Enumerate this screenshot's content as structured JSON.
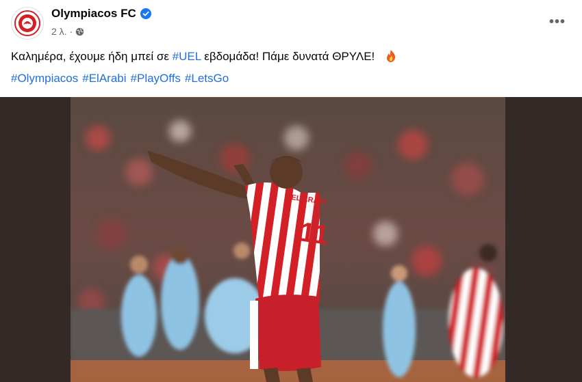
{
  "post": {
    "author": "Olympiacos FC",
    "time": "2 λ.",
    "text_before": "Καλημέρα, έχουμε ήδη μπεί σε ",
    "text_tag": "#UEL",
    "text_after": " εβδομάδα! Πάμε δυνατά ΘΡΥΛΕ!",
    "hashtags": [
      "#Olympiacos",
      "#ElArabi",
      "#PlayOffs",
      "#LetsGo"
    ],
    "more_label": "•••"
  },
  "icons": {
    "avatar": "olympiacos-crest-icon",
    "verified": "verified-badge-icon",
    "privacy": "globe-icon",
    "emoji": "fire-icon",
    "more": "more-options-icon"
  },
  "photo": {
    "jersey_number": "11",
    "player_name": "EL ARABI"
  },
  "colors": {
    "link": "#216fdb",
    "verified": "#1877f2",
    "olympiacos_red": "#d32027",
    "opponent_blue": "#8fc3e3"
  }
}
